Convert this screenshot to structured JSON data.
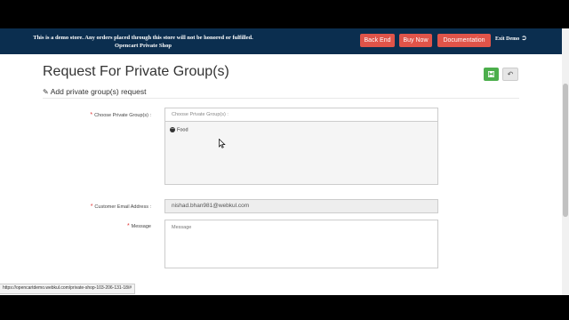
{
  "demo_bar": {
    "line1": "This is a demo store. Any orders placed through this store will not be honored or fulfilled.",
    "line2": "Opencart Private Shop",
    "back_end": "Back End",
    "buy_now": "Buy Now",
    "documentation": "Documentation",
    "exit_demo": "Exit Demo"
  },
  "page": {
    "title": "Request For Private Group(s)",
    "subtitle": "Add private group(s) request"
  },
  "form": {
    "groups_label": "Choose Private Group(s) :",
    "groups_placeholder": "Choose Private Group(s) :",
    "selected_groups": [
      "Food"
    ],
    "email_label": "Customer Email Address :",
    "email_value": "nishad.bhan981@webkul.com",
    "message_label": "Message",
    "message_placeholder": "Message"
  },
  "status_bar": {
    "url": "https://opencartdemo.webkul.com/private-shop-103-206-131-18/#"
  },
  "icons": {
    "save": "floppy-disk-icon",
    "back": "reply-arrow-icon",
    "pencil": "pencil-icon",
    "exit": "sign-out-icon",
    "remove": "minus-circle-icon"
  },
  "colors": {
    "demo_bar": "#0b2e4f",
    "demo_button": "#e05449",
    "save_button": "#4cae4c",
    "required": "#e03030"
  }
}
